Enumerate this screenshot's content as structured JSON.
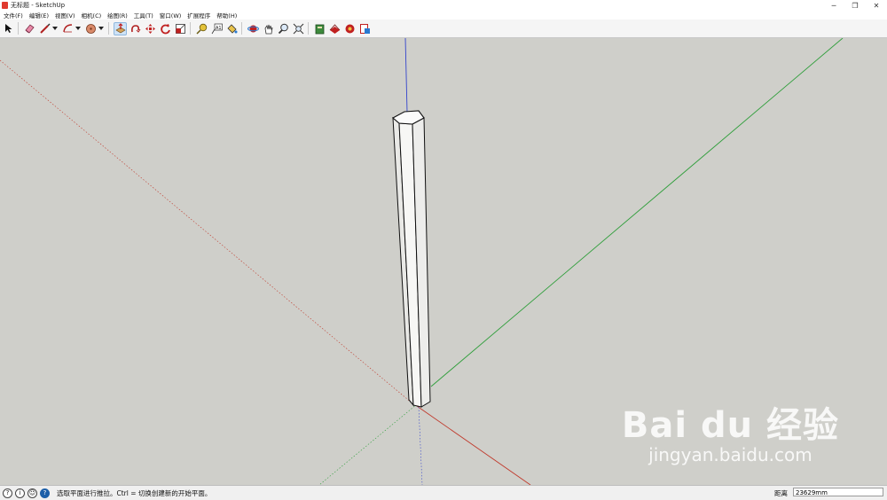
{
  "window": {
    "title": "无标题 - SketchUp",
    "minimize": "─",
    "restore": "❐",
    "close": "✕"
  },
  "menu": {
    "items": [
      "文件(F)",
      "编辑(E)",
      "视图(V)",
      "相机(C)",
      "绘图(R)",
      "工具(T)",
      "窗口(W)",
      "扩展程序",
      "帮助(H)"
    ]
  },
  "toolbar": {
    "tools": [
      "select-icon",
      "eraser-icon",
      "pencil-line-icon",
      "arc-icon",
      "shape-icon",
      "push-pull-icon",
      "follow-me-icon",
      "move-icon",
      "rotate-icon",
      "scale-icon",
      "tape-measure-icon",
      "text-icon",
      "paint-bucket-icon",
      "orbit-icon",
      "pan-icon",
      "zoom-icon",
      "zoom-extents-icon",
      "warehouse-icon",
      "extension-warehouse-icon",
      "layout-icon",
      "styles-icon"
    ]
  },
  "status": {
    "message": "选取平面进行推拉。Ctrl = 切换创建新的开始平面。",
    "measurement_label": "距离",
    "measurement_value": "23629mm"
  },
  "watermark": {
    "logo": "Bai du 经验",
    "site": "jingyan.baidu.com"
  },
  "colors": {
    "viewport_bg": "#cfcfca",
    "red_axis": "#c0392b",
    "green_axis": "#2e9e3a",
    "blue_axis": "#3344cc"
  }
}
